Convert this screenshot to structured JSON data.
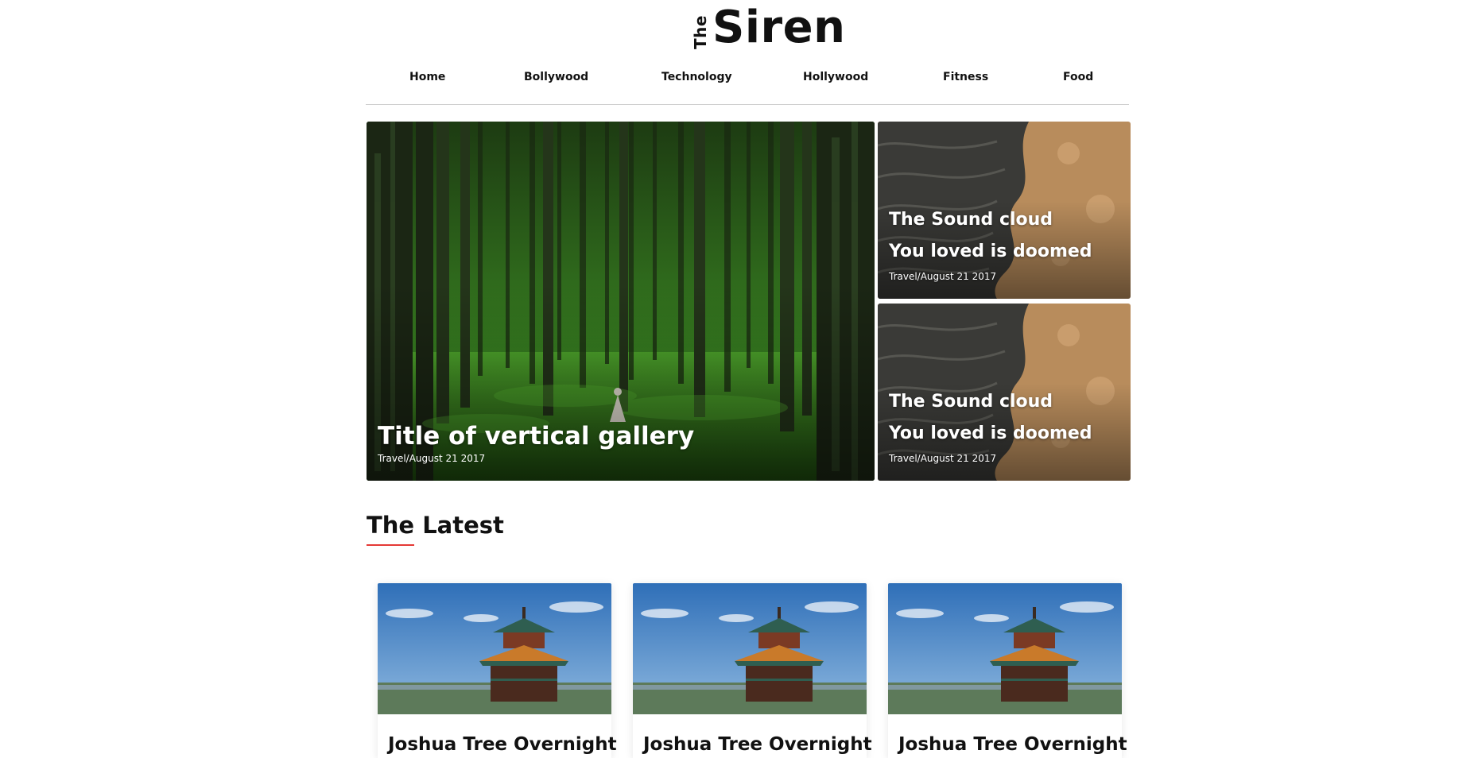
{
  "brand": {
    "prefix": "The",
    "name": "Siren"
  },
  "nav": {
    "items": [
      {
        "label": "Home"
      },
      {
        "label": "Bollywood"
      },
      {
        "label": "Technology"
      },
      {
        "label": "Hollywood"
      },
      {
        "label": "Fitness"
      },
      {
        "label": "Food"
      }
    ]
  },
  "featured": {
    "main": {
      "title": "Title of vertical gallery",
      "meta": "Travel/August 21 2017"
    },
    "side": [
      {
        "line1": "The Sound cloud",
        "line2": "You loved is doomed",
        "meta": "Travel/August 21 2017"
      },
      {
        "line1": "The Sound cloud",
        "line2": "You loved is doomed",
        "meta": "Travel/August 21 2017"
      }
    ]
  },
  "latest": {
    "heading": "The Latest",
    "accent_color": "#e53935",
    "posts": [
      {
        "title": "Joshua Tree Overnight"
      },
      {
        "title": "Joshua Tree Overnight"
      },
      {
        "title": "Joshua Tree Overnight"
      }
    ]
  }
}
